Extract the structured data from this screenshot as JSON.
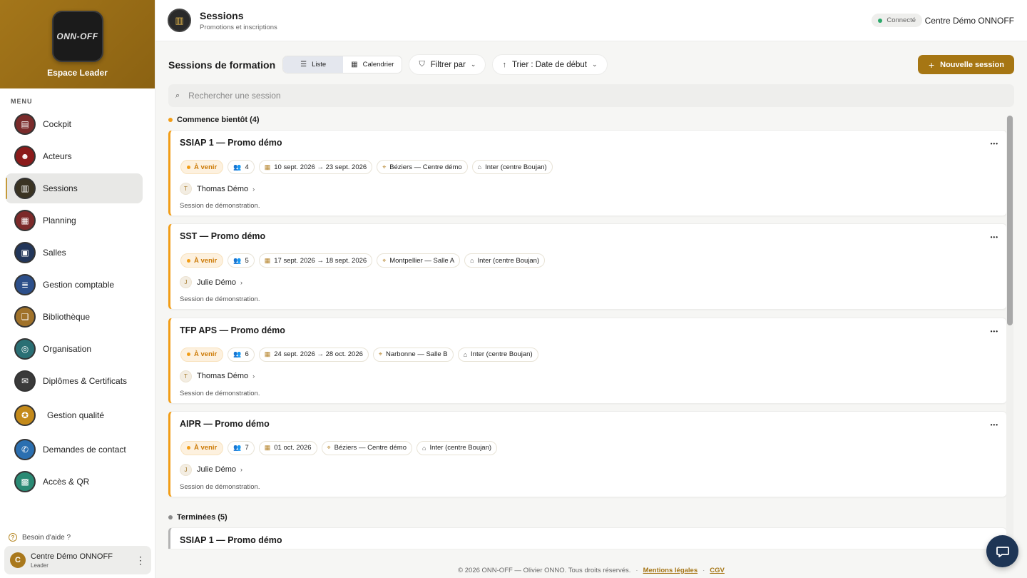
{
  "brand": {
    "logo_text": "ONN-OFF",
    "title": "Espace Leader"
  },
  "menu": {
    "label": "MENU",
    "items": [
      {
        "label": "Cockpit",
        "icon": "dashboard-icon",
        "color": "#7a2b2b",
        "glyph": "▤"
      },
      {
        "label": "Acteurs",
        "icon": "people-icon",
        "color": "#8b1a1a",
        "glyph": "☻"
      },
      {
        "label": "Sessions",
        "icon": "sessions-icon",
        "color": "#3a3322",
        "glyph": "▥"
      },
      {
        "label": "Planning",
        "icon": "calendar-icon",
        "color": "#7c2a2a",
        "glyph": "▦"
      },
      {
        "label": "Salles",
        "icon": "room-icon",
        "color": "#22365a",
        "glyph": "▣"
      },
      {
        "label": "Gestion comptable",
        "icon": "accounting-icon",
        "color": "#2c4f8a",
        "glyph": "≣"
      },
      {
        "label": "Bibliothèque",
        "icon": "library-icon",
        "color": "#a0722a",
        "glyph": "❏"
      },
      {
        "label": "Organisation",
        "icon": "organisation-icon",
        "color": "#2a6f74",
        "glyph": "◎"
      },
      {
        "label": "Diplômes & Certificats",
        "icon": "diploma-icon",
        "color": "#3a3a3a",
        "glyph": "✉"
      },
      {
        "label": "Gestion qualité",
        "icon": "quality-icon",
        "color": "#c48a1a",
        "glyph": "✪"
      },
      {
        "label": "Demandes de contact",
        "icon": "contact-icon",
        "color": "#2b6fb0",
        "glyph": "✆"
      },
      {
        "label": "Accès & QR",
        "icon": "qr-icon",
        "color": "#2a8a74",
        "glyph": "▩"
      }
    ]
  },
  "help": {
    "label": "Besoin d'aide ?"
  },
  "user": {
    "initial": "C",
    "name": "Centre Démo ONNOFF",
    "role": "Leader"
  },
  "header": {
    "title": "Sessions",
    "subtitle": "Promotions et inscriptions",
    "status": "Connecté",
    "org": "Centre Démo ONNOFF"
  },
  "toolbar": {
    "title": "Sessions de formation",
    "view_list": "Liste",
    "view_calendar": "Calendrier",
    "filter": "Filtrer par",
    "sort": "Trier : Date de début",
    "new_session": "Nouvelle session"
  },
  "search": {
    "placeholder": "Rechercher une session"
  },
  "groups": {
    "upcoming": {
      "label": "Commence bientôt (4)",
      "color": "#f29d16"
    },
    "finished": {
      "label": "Terminées (5)",
      "color": "#8a8a8a"
    }
  },
  "sessions": [
    {
      "title": "SSIAP 1 — Promo démo",
      "status": "À venir",
      "count": "4",
      "dates": "10 sept. 2026 → 23 sept. 2026",
      "location": "Béziers — Centre démo",
      "type": "Inter (centre Boujan)",
      "trainer_initial": "T",
      "trainer": "Thomas Démo",
      "description": "Session de démonstration."
    },
    {
      "title": "SST — Promo démo",
      "status": "À venir",
      "count": "5",
      "dates": "17 sept. 2026 → 18 sept. 2026",
      "location": "Montpellier — Salle A",
      "type": "Inter (centre Boujan)",
      "trainer_initial": "J",
      "trainer": "Julie Démo",
      "description": "Session de démonstration."
    },
    {
      "title": "TFP APS — Promo démo",
      "status": "À venir",
      "count": "6",
      "dates": "24 sept. 2026 → 28 oct. 2026",
      "location": "Narbonne — Salle B",
      "type": "Inter (centre Boujan)",
      "trainer_initial": "T",
      "trainer": "Thomas Démo",
      "description": "Session de démonstration."
    },
    {
      "title": "AIPR — Promo démo",
      "status": "À venir",
      "count": "7",
      "dates": "01 oct. 2026",
      "location": "Béziers — Centre démo",
      "type": "Inter (centre Boujan)",
      "trainer_initial": "J",
      "trainer": "Julie Démo",
      "description": "Session de démonstration."
    }
  ],
  "finished_sessions": [
    {
      "title": "SSIAP 1 — Promo démo"
    }
  ],
  "footer": {
    "copyright": "© 2026 ONN-OFF — Olivier ONNO. Tous droits réservés.",
    "legal": "Mentions légales",
    "cgv": "CGV"
  }
}
